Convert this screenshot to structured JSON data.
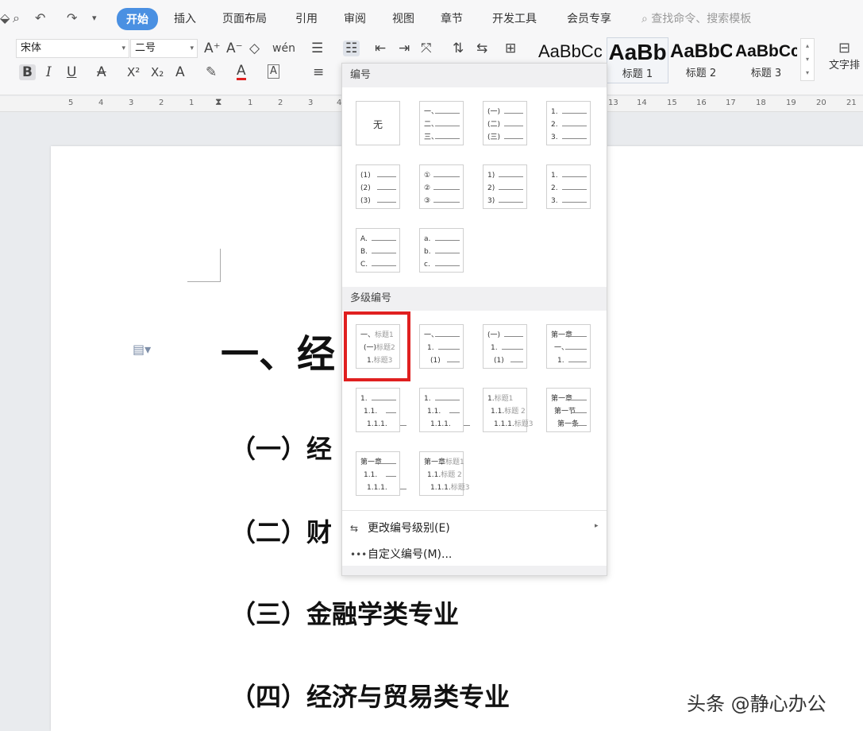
{
  "menubar": {
    "quick_icons": [
      "save-icon",
      "print-preview-icon",
      "undo-icon",
      "redo-icon",
      "more-icon"
    ],
    "undo": "↶",
    "redo": "↷",
    "more": "▾",
    "tabs": [
      "开始",
      "插入",
      "页面布局",
      "引用",
      "审阅",
      "视图",
      "章节",
      "开发工具",
      "会员专享"
    ],
    "active_tab": "开始",
    "search_placeholder": "查找命令、搜索模板"
  },
  "ribbon": {
    "font_name": "宋体",
    "font_size": "二号",
    "grow_font": "A⁺",
    "shrink_font": "A⁻",
    "clear_format": "◇",
    "pinyin": "wén",
    "bold": "B",
    "italic": "I",
    "underline": "U",
    "strikethrough": "A",
    "superscript": "X²",
    "subscript": "X₂",
    "text_effect": "A",
    "highlight": "✎",
    "font_color": "A",
    "char_border": "A",
    "styles": [
      {
        "preview": "AaBbCcDd",
        "label": ""
      },
      {
        "preview": "AaBb",
        "label": "标题 1"
      },
      {
        "preview": "AaBbC",
        "label": "标题 2"
      },
      {
        "preview": "AaBbCc",
        "label": "标题 3"
      }
    ],
    "text_layout": "文字排"
  },
  "ruler": {
    "ticks": [
      "5",
      "4",
      "3",
      "2",
      "1",
      "1",
      "2",
      "3",
      "4",
      "13",
      "14",
      "15",
      "16",
      "17",
      "18",
      "19",
      "20",
      "21"
    ]
  },
  "document": {
    "heading1": "一、经",
    "headings2": [
      "（一）经",
      "（二）财",
      "（三）金融学类专业",
      "（四）经济与贸易类专业"
    ]
  },
  "numbering_menu": {
    "section_numbering": "编号",
    "section_multilevel": "多级编号",
    "none_label": "无",
    "tiles_single": [
      [
        "一、",
        "二、",
        "三、"
      ],
      [
        "(一)",
        "(二)",
        "(三)"
      ],
      [
        "1.",
        "2.",
        "3."
      ],
      [
        "(1)",
        "(2)",
        "(3)"
      ],
      [
        "①",
        "②",
        "③"
      ],
      [
        "1)",
        "2)",
        "3)"
      ],
      [
        "1.",
        "2.",
        "3."
      ],
      [
        "A.",
        "B.",
        "C."
      ],
      [
        "a.",
        "b.",
        "c."
      ]
    ],
    "tiles_multi": [
      [
        {
          "n": "一、",
          "t": "标题1"
        },
        {
          "n": "(一)",
          "t": "标题2"
        },
        {
          "n": "1.",
          "t": "标题3"
        }
      ],
      [
        {
          "n": "一、",
          "t": ""
        },
        {
          "n": "1.",
          "t": ""
        },
        {
          "n": "(1)",
          "t": ""
        }
      ],
      [
        {
          "n": "(一)",
          "t": ""
        },
        {
          "n": "1.",
          "t": ""
        },
        {
          "n": "(1)",
          "t": ""
        }
      ],
      [
        {
          "n": "第一章",
          "t": ""
        },
        {
          "n": "一、",
          "t": ""
        },
        {
          "n": "1.",
          "t": ""
        }
      ],
      [
        {
          "n": "1.",
          "t": ""
        },
        {
          "n": "1.1.",
          "t": ""
        },
        {
          "n": "1.1.1.",
          "t": ""
        }
      ],
      [
        {
          "n": "1.",
          "t": ""
        },
        {
          "n": "1.1.",
          "t": ""
        },
        {
          "n": "1.1.1.",
          "t": ""
        }
      ],
      [
        {
          "n": "1.",
          "t": "标题1"
        },
        {
          "n": "1.1.",
          "t": "标题 2"
        },
        {
          "n": "1.1.1.",
          "t": "标题3"
        }
      ],
      [
        {
          "n": "第一章",
          "t": ""
        },
        {
          "n": "第一节",
          "t": ""
        },
        {
          "n": "第一条",
          "t": ""
        }
      ],
      [
        {
          "n": "第一章",
          "t": ""
        },
        {
          "n": "1.1.",
          "t": ""
        },
        {
          "n": "1.1.1.",
          "t": ""
        }
      ],
      [
        {
          "n": "第一章",
          "t": "标题1"
        },
        {
          "n": "1.1.",
          "t": "标题 2"
        },
        {
          "n": "1.1.1.",
          "t": "标题3"
        }
      ]
    ],
    "change_level": "更改编号级别(E)",
    "custom": "自定义编号(M)...",
    "highlight_color": "#e02020"
  },
  "watermark": "头条 @静心办公"
}
